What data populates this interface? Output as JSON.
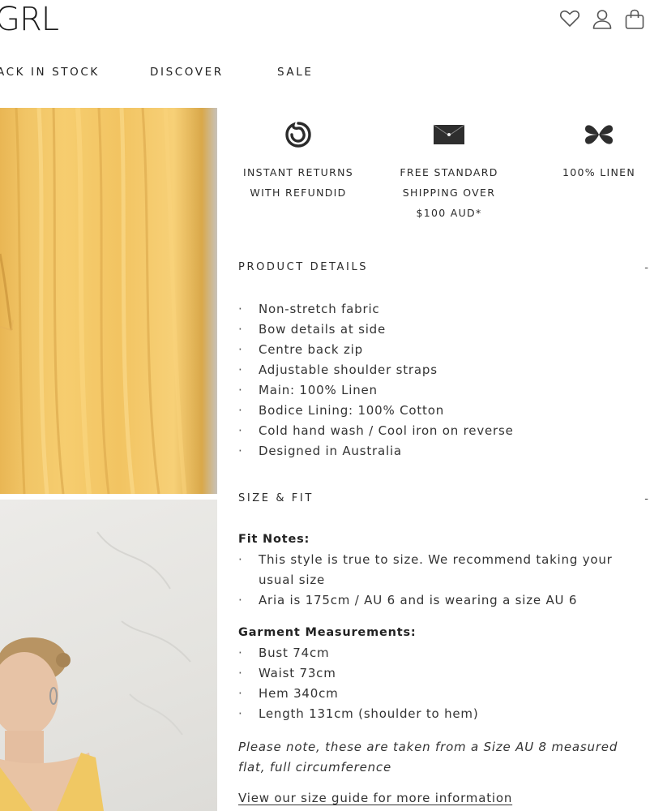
{
  "header": {
    "logo": "GRL",
    "icons": [
      "heart-icon",
      "user-icon",
      "bag-icon"
    ]
  },
  "nav": {
    "items": [
      "ACK IN STOCK",
      "DISCOVER",
      "SALE"
    ]
  },
  "features": [
    {
      "icon": "refund-circle-icon",
      "label_lines": [
        "INSTANT RETURNS",
        "WITH REFUNDID"
      ]
    },
    {
      "icon": "envelope-icon",
      "label_lines": [
        "FREE STANDARD",
        "SHIPPING OVER",
        "$100 AUD*"
      ]
    },
    {
      "icon": "linen-flower-icon",
      "label_lines": [
        "100% LINEN"
      ]
    }
  ],
  "product_details": {
    "title": "PRODUCT DETAILS",
    "toggle": "-",
    "items": [
      "Non-stretch fabric",
      "Bow details at side",
      "Centre back zip",
      "Adjustable shoulder straps",
      "Main: 100% Linen",
      "Bodice Lining: 100% Cotton",
      "Cold hand wash / Cool iron on reverse",
      "Designed in Australia"
    ]
  },
  "size_fit": {
    "title": "SIZE & FIT",
    "toggle": "-",
    "fit_notes_heading": "Fit Notes:",
    "fit_notes": [
      "This style is true to size. We recommend taking your usual size",
      "Aria is 175cm / AU 6 and is wearing a size AU 6"
    ],
    "measurements_heading": "Garment Measurements:",
    "measurements": [
      "Bust 74cm",
      "Waist 73cm",
      "Hem 340cm",
      "Length 131cm (shoulder to hem)"
    ],
    "note": "Please note, these are taken from a Size AU 8 measured flat, full circumference",
    "guide_link": "View our size guide for more information"
  },
  "colors": {
    "text": "#2b2b2b",
    "dress_yellow": "#f2c462",
    "wall_grey": "#e4e3df"
  }
}
